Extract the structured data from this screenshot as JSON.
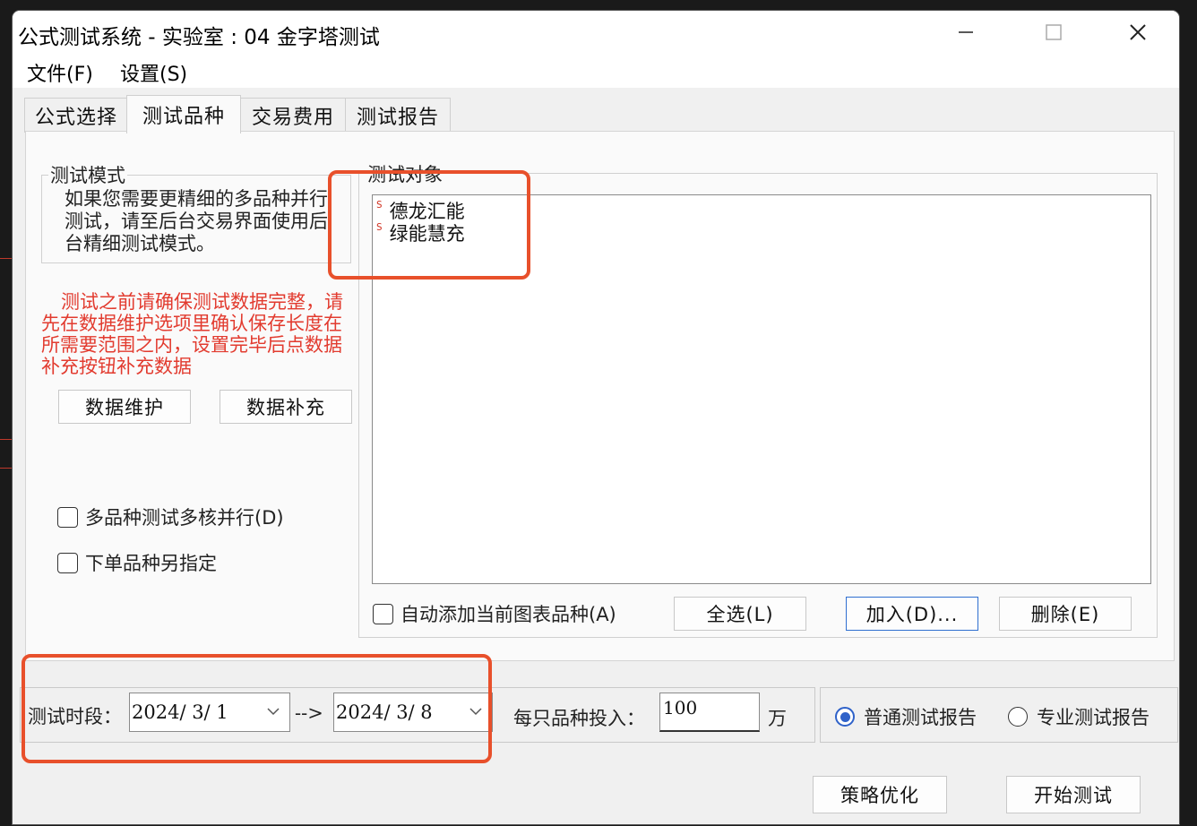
{
  "window": {
    "title": "公式测试系统 - 实验室 : 04 金字塔测试",
    "minimize_icon": "minimize-icon",
    "maximize_icon": "maximize-icon",
    "close_icon": "close-icon"
  },
  "menu": {
    "file": "文件(F)",
    "settings": "设置(S)"
  },
  "tabs": [
    {
      "label": "公式选择"
    },
    {
      "label": "测试品种"
    },
    {
      "label": "交易费用"
    },
    {
      "label": "测试报告"
    }
  ],
  "mode_group": {
    "label": "测试模式",
    "text": "如果您需要更精细的多品种并行测试，请至后台交易界面使用后台精细测试模式。"
  },
  "warning": {
    "text": "测试之前请确保测试数据完整，请先在数据维护选项里确认保存长度在所需要范围之内，设置完毕后点数据补充按钮补充数据",
    "color": "#e23b2f"
  },
  "buttons": {
    "data_maintain": "数据维护",
    "data_supplement": "数据补充",
    "select_all": "全选(L)",
    "add": "加入(D)...",
    "delete": "删除(E)",
    "optimize": "策略优化",
    "start_test": "开始测试"
  },
  "checkboxes": {
    "multi_core": "多品种测试多核并行(D)",
    "order_symbol": "下单品种另指定",
    "auto_add": "自动添加当前图表品种(A)"
  },
  "target_group": {
    "label": "测试对象",
    "items": [
      {
        "icon": "S",
        "name": "德龙汇能"
      },
      {
        "icon": "S",
        "name": "绿能慧充"
      }
    ]
  },
  "period": {
    "label": "测试时段：",
    "start": "2024/ 3/ 1",
    "arrow": "-->",
    "end": "2024/ 3/ 8"
  },
  "investment": {
    "label": "每只品种投入：",
    "value": "100",
    "unit": "万"
  },
  "report_type": {
    "normal": "普通测试报告",
    "pro": "专业测试报告",
    "selected": "normal"
  },
  "colors": {
    "accent": "#2f62c9",
    "annotation": "#e8502b"
  }
}
